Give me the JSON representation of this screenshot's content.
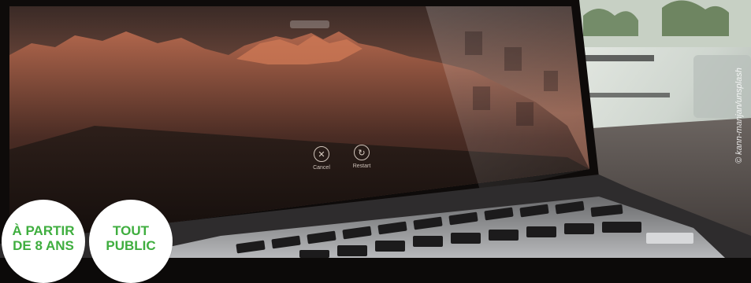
{
  "photo": {
    "subject": "laptop-lock-screen",
    "lock_screen": {
      "buttons": [
        {
          "label": "Cancel",
          "icon": "close-icon"
        },
        {
          "label": "Restart",
          "icon": "restart-icon"
        }
      ]
    }
  },
  "badges": {
    "age": {
      "line1": "À PARTIR",
      "line2": "DE 8 ANS"
    },
    "public": {
      "line1": "TOUT",
      "line2": "PUBLIC"
    }
  },
  "credit": "© kann-manjan/unsplash",
  "colors": {
    "badge_text": "#3fae3f",
    "badge_bg": "#ffffff"
  }
}
